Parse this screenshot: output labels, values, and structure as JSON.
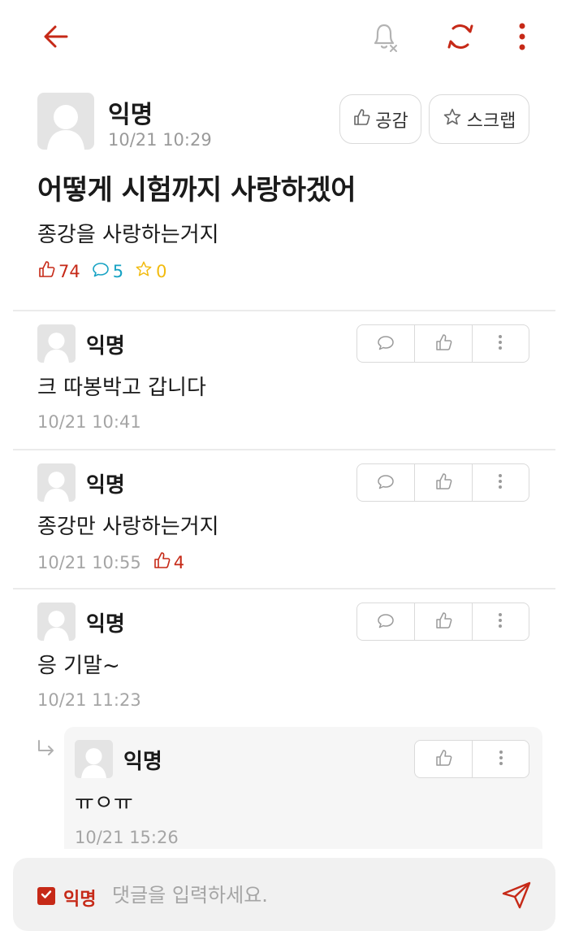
{
  "colors": {
    "accent": "#c62917",
    "comment_blue": "#18a3c4",
    "scrap_yellow": "#f2bb0f",
    "muted": "#a5a5a5"
  },
  "topbar": {
    "icons": [
      "back-arrow-icon",
      "notification-off-icon",
      "refresh-icon",
      "more-vertical-icon"
    ]
  },
  "post": {
    "author": "익명",
    "time": "10/21 10:29",
    "like_button_label": "공감",
    "scrap_button_label": "스크랩",
    "title": "어떻게 시험까지 사랑하겠어",
    "body": "종강을 사랑하는거지",
    "stats": {
      "likes": "74",
      "comments": "5",
      "scraps": "0"
    }
  },
  "comments": [
    {
      "author": "익명",
      "text": "크 따봉박고 갑니다",
      "time": "10/21 10:41",
      "likes": ""
    },
    {
      "author": "익명",
      "text": "종강만 사랑하는거지",
      "time": "10/21 10:55",
      "likes": "4"
    },
    {
      "author": "익명",
      "text": "응 기말~",
      "time": "10/21 11:23",
      "likes": ""
    }
  ],
  "reply": {
    "author": "익명",
    "text": "ㅠㅇㅠ",
    "time": "10/21 15:26"
  },
  "composer": {
    "anonymous_label": "익명",
    "anonymous_checked": true,
    "placeholder": "댓글을 입력하세요."
  }
}
